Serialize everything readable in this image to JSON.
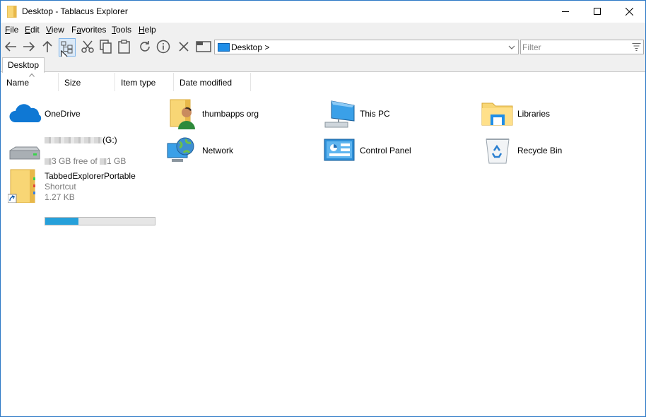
{
  "window": {
    "title": "Desktop - Tablacus Explorer",
    "minimize_label": "",
    "maximize_label": "",
    "close_label": ""
  },
  "menu": {
    "items": [
      {
        "label_u": "F",
        "label_rest": "ile"
      },
      {
        "label_u": "E",
        "label_rest": "dit"
      },
      {
        "label_u": "V",
        "label_rest": "iew"
      },
      {
        "label_pre": "F",
        "label_u": "a",
        "label_rest": "vorites"
      },
      {
        "label_u": "T",
        "label_rest": "ools"
      },
      {
        "label_u": "H",
        "label_rest": "elp"
      }
    ]
  },
  "toolbar": {
    "address": "Desktop >",
    "filter_placeholder": "Filter"
  },
  "tabs": [
    {
      "label": "Desktop",
      "active": true
    }
  ],
  "columns": [
    {
      "label": "Name"
    },
    {
      "label": "Size"
    },
    {
      "label": "Item type"
    },
    {
      "label": "Date modified"
    }
  ],
  "items": {
    "onedrive": {
      "name": "OneDrive"
    },
    "user": {
      "name": "thumbapps org"
    },
    "thispc": {
      "name": "This PC"
    },
    "libraries": {
      "name": "Libraries"
    },
    "drive": {
      "name": "(G:)",
      "free_a": "3 GB free of ",
      "free_b": "1 GB",
      "used_fraction": 0.3
    },
    "network": {
      "name": "Network"
    },
    "controlpanel": {
      "name": "Control Panel"
    },
    "recyclebin": {
      "name": "Recycle Bin"
    },
    "shortcut": {
      "name": "TabbedExplorerPortable",
      "type": "Shortcut",
      "size": "1.27 KB"
    }
  },
  "colors": {
    "accent": "#2b78c5",
    "drive_bar": "#26a0da",
    "chrome": "#f0f0f0"
  }
}
